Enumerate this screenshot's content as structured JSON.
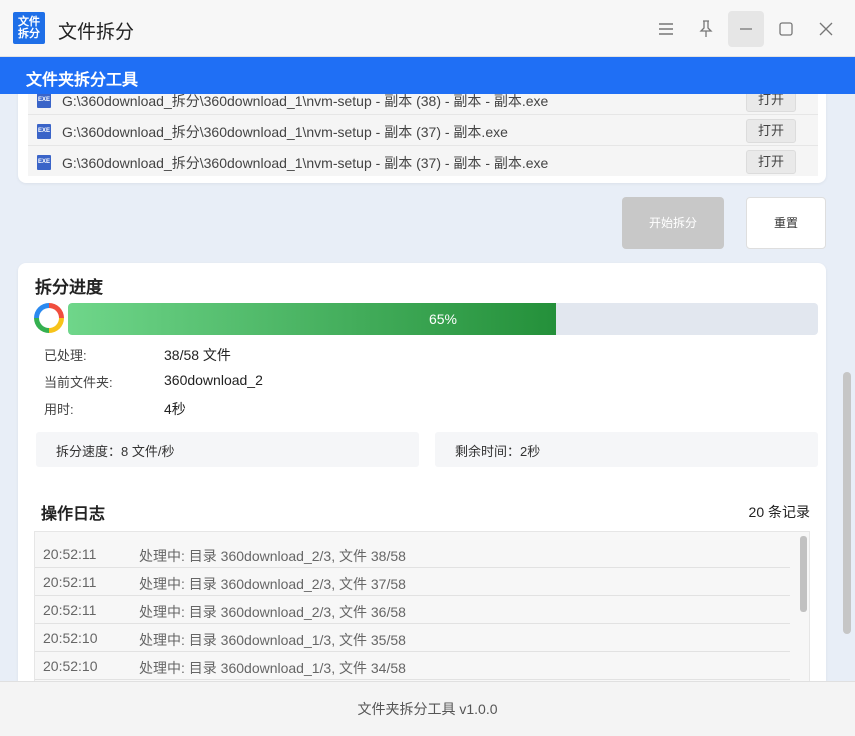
{
  "window": {
    "logo_line1": "文件",
    "logo_line2": "拆分",
    "title": "文件拆分"
  },
  "appbar": {
    "title": "文件夹拆分工具"
  },
  "files": [
    {
      "icon": "EXE",
      "path": "G:\\360download_拆分\\360download_1\\nvm-setup - 副本 (38) - 副本 - 副本.exe",
      "open": "打开"
    },
    {
      "icon": "EXE",
      "path": "G:\\360download_拆分\\360download_1\\nvm-setup - 副本 (37) - 副本.exe",
      "open": "打开"
    },
    {
      "icon": "EXE",
      "path": "G:\\360download_拆分\\360download_1\\nvm-setup - 副本 (37) - 副本 - 副本.exe",
      "open": "打开"
    }
  ],
  "actions": {
    "start": "开始拆分",
    "reset": "重置"
  },
  "progress": {
    "title": "拆分进度",
    "percent": 65,
    "percent_label": "65%",
    "stats": [
      {
        "label": "已处理:",
        "value": "38/58 文件"
      },
      {
        "label": "当前文件夹:",
        "value": "360download_2"
      },
      {
        "label": "用时:",
        "value": "4秒"
      }
    ],
    "speed": "拆分速度：8 文件/秒",
    "remaining": "剩余时间：2秒"
  },
  "log": {
    "title": "操作日志",
    "count": "20 条记录",
    "entries": [
      {
        "time": "20:52:11",
        "msg": "处理中: 目录 360download_2/3, 文件 38/58"
      },
      {
        "time": "20:52:11",
        "msg": "处理中: 目录 360download_2/3, 文件 37/58"
      },
      {
        "time": "20:52:11",
        "msg": "处理中: 目录 360download_2/3, 文件 36/58"
      },
      {
        "time": "20:52:10",
        "msg": "处理中: 目录 360download_1/3, 文件 35/58"
      },
      {
        "time": "20:52:10",
        "msg": "处理中: 目录 360download_1/3, 文件 34/58"
      }
    ]
  },
  "footer": {
    "text": "文件夹拆分工具 v1.0.0"
  },
  "colors": {
    "accent": "#1f6ff5",
    "progress_start": "#6fd68a",
    "progress_end": "#24903a",
    "disabled": "#c8c8c8"
  },
  "icons": {
    "menu": "menu-icon",
    "pin": "pin-icon",
    "minimize": "minimize-icon",
    "maximize": "maximize-icon",
    "close": "close-icon",
    "file": "exe-file-icon",
    "spinner": "loading-spinner-icon"
  }
}
